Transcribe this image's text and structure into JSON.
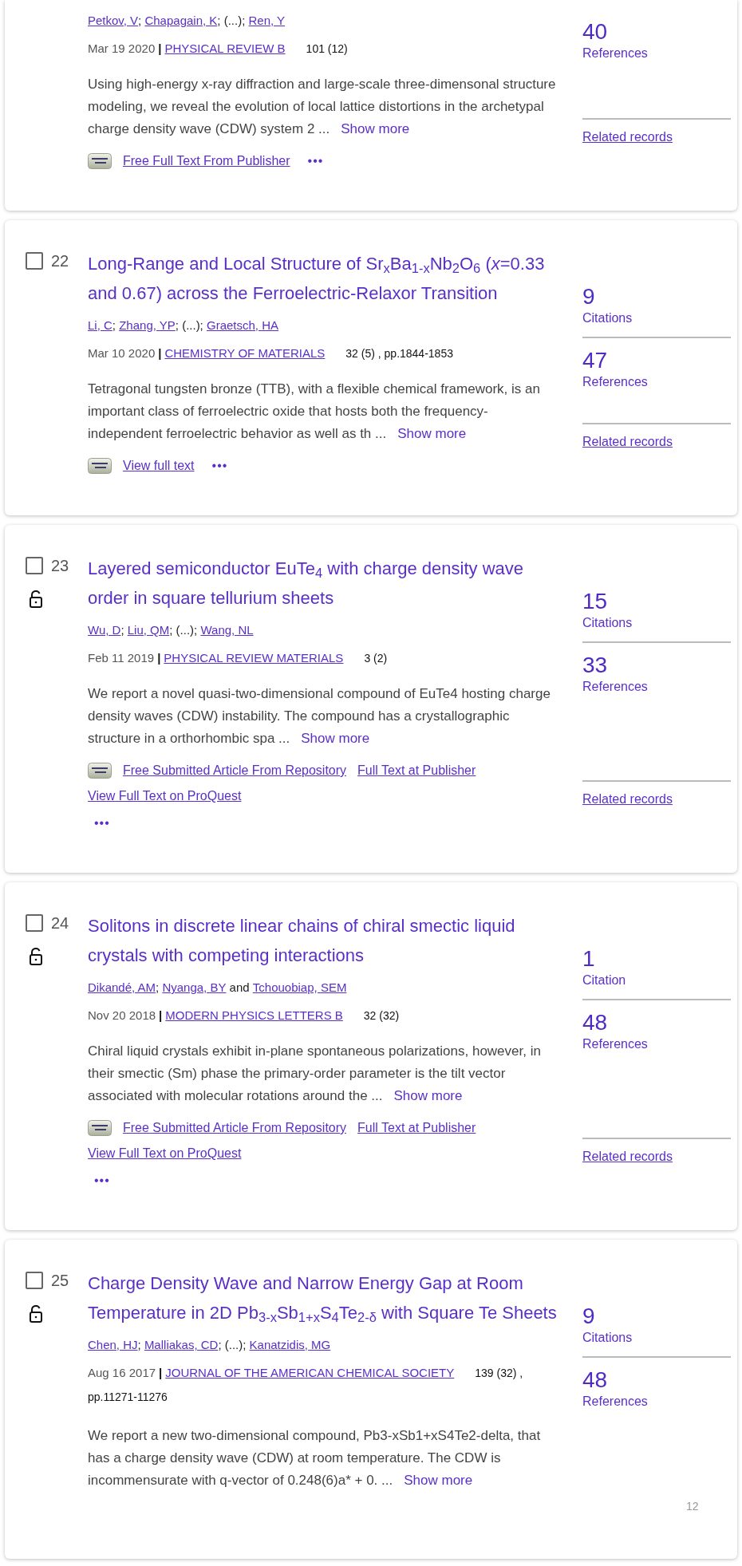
{
  "records": [
    {
      "authors": [
        {
          "kind": "author",
          "text": "Petkov, V"
        },
        {
          "kind": "separator",
          "text": "; "
        },
        {
          "kind": "author",
          "text": "Chapagain, K"
        },
        {
          "kind": "separator",
          "text": "; (...); "
        },
        {
          "kind": "author",
          "text": "Ren, Y"
        }
      ],
      "date": "Mar 19 2020",
      "date_divider": "|",
      "journal": "PHYSICAL REVIEW B",
      "volume": "101 (12)",
      "abstract": "Using high-energy x-ray diffraction and large-scale three-dimensonal structure modeling, we reveal the evolution of local lattice distortions in the archetypal charge density wave (CDW) system 2 ...",
      "show_more": "Show more",
      "links": [
        "Free Full Text From Publisher"
      ],
      "more": "•••",
      "metrics": [
        {
          "count": "40",
          "label": "References"
        }
      ],
      "related": "Related records"
    },
    {
      "number": "22",
      "checked": false,
      "open_access": false,
      "title": "Long-Range and Local Structure of Sr$_{x}$Ba$_{1-x}$Nb$_{2}$O$_{6}$ (*x*=0.33 and 0.67) across the Ferroelectric-Relaxor Transition",
      "authors": [
        {
          "kind": "author",
          "text": "Li, C"
        },
        {
          "kind": "separator",
          "text": "; "
        },
        {
          "kind": "author",
          "text": "Zhang, YP"
        },
        {
          "kind": "separator",
          "text": "; (...); "
        },
        {
          "kind": "author",
          "text": "Graetsch, HA"
        }
      ],
      "date": "Mar 10 2020",
      "date_divider": "|",
      "journal": "CHEMISTRY OF MATERIALS",
      "volume": "32 (5) , pp.1844-1853",
      "abstract": "Tetragonal tungsten bronze (TTB), with a flexible chemical framework, is an important class of ferroelectric oxide that hosts both the frequency-independent ferroelectric behavior as well as th ...",
      "show_more": "Show more",
      "links": [
        "View full text"
      ],
      "more": "•••",
      "metrics": [
        {
          "count": "9",
          "label": "Citations"
        },
        {
          "count": "47",
          "label": "References"
        }
      ],
      "related": "Related records"
    },
    {
      "number": "23",
      "checked": false,
      "open_access": true,
      "title": "Layered semiconductor EuTe$_{4}$ with charge density wave order in square tellurium sheets",
      "authors": [
        {
          "kind": "author",
          "text": "Wu, D"
        },
        {
          "kind": "separator",
          "text": "; "
        },
        {
          "kind": "author",
          "text": "Liu, QM"
        },
        {
          "kind": "separator",
          "text": "; (...); "
        },
        {
          "kind": "author",
          "text": "Wang, NL"
        }
      ],
      "date": "Feb 11 2019",
      "date_divider": "|",
      "journal": "PHYSICAL REVIEW MATERIALS",
      "volume": "3 (2)",
      "abstract": "We report a novel quasi-two-dimensional compound of EuTe4 hosting charge density waves (CDW) instability. The compound has a crystallographic structure in a orthorhombic spa ...",
      "show_more": "Show more",
      "links": [
        "Free Submitted Article From Repository",
        "Full Text at Publisher",
        "View Full Text on ProQuest"
      ],
      "more": "•••",
      "metrics": [
        {
          "count": "15",
          "label": "Citations"
        },
        {
          "count": "33",
          "label": "References"
        }
      ],
      "related": "Related records"
    },
    {
      "number": "24",
      "checked": false,
      "open_access": true,
      "title": "Solitons in discrete linear chains of chiral smectic liquid crystals with competing interactions",
      "authors": [
        {
          "kind": "author",
          "text": "Dikandé, AM"
        },
        {
          "kind": "separator",
          "text": "; "
        },
        {
          "kind": "author",
          "text": "Nyanga, BY"
        },
        {
          "kind": "separator",
          "text": " and "
        },
        {
          "kind": "author",
          "text": "Tchouobiap, SEM"
        }
      ],
      "date": "Nov 20 2018",
      "date_divider": "|",
      "journal": "MODERN PHYSICS LETTERS B",
      "volume": "32 (32)",
      "abstract": "Chiral liquid crystals exhibit in-plane spontaneous polarizations, however, in their smectic (Sm) phase the primary-order parameter is the tilt vector associated with molecular rotations around the ...",
      "show_more": "Show more",
      "links": [
        "Free Submitted Article From Repository",
        "Full Text at Publisher",
        "View Full Text on ProQuest"
      ],
      "more": "•••",
      "metrics": [
        {
          "count": "1",
          "label": "Citation"
        },
        {
          "count": "48",
          "label": "References"
        }
      ],
      "related": "Related records"
    },
    {
      "number": "25",
      "checked": false,
      "open_access": true,
      "title": "Charge Density Wave and Narrow Energy Gap at Room Temperature in 2D Pb$_{3-x}$Sb$_{1+x}$S$_{4}$Te$_{2-δ}$ with Square Te Sheets",
      "authors": [
        {
          "kind": "author",
          "text": "Chen, HJ"
        },
        {
          "kind": "separator",
          "text": "; "
        },
        {
          "kind": "author",
          "text": "Malliakas, CD"
        },
        {
          "kind": "separator",
          "text": "; (...); "
        },
        {
          "kind": "author",
          "text": "Kanatzidis, MG"
        }
      ],
      "date": "Aug 16 2017",
      "date_divider": "|",
      "journal": "JOURNAL OF THE AMERICAN CHEMICAL SOCIETY",
      "volume": "139 (32) ,",
      "pages": "pp.11271-11276",
      "abstract": "We report a new two-dimensional compound, Pb3-xSb1+xS4Te2-delta, that has a charge density wave (CDW) at room temperature. The CDW is incommensurate with q-vector of 0.248(6)a* + 0. ...",
      "show_more": "Show more",
      "metrics": [
        {
          "count": "9",
          "label": "Citations"
        },
        {
          "count": "48",
          "label": "References"
        }
      ],
      "page_number": "12"
    }
  ]
}
